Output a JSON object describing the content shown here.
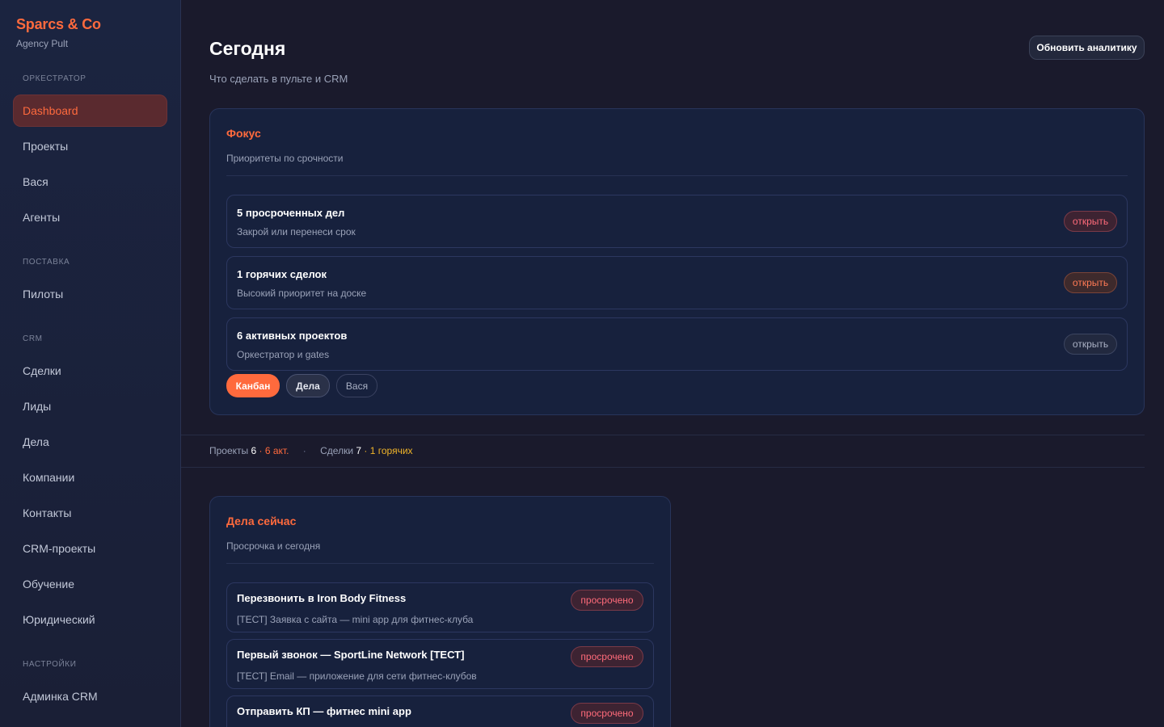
{
  "brand": {
    "title": "Sparcs & Co",
    "subtitle": "Agency Pult"
  },
  "sidebar": {
    "sections": [
      {
        "label": "ОРКЕСТРАТОР"
      },
      {
        "label": "ПОСТАВКА"
      },
      {
        "label": "CRM"
      },
      {
        "label": "НАСТРОЙКИ"
      }
    ],
    "items": [
      {
        "label": "Dashboard"
      },
      {
        "label": "Проекты"
      },
      {
        "label": "Вася"
      },
      {
        "label": "Агенты"
      },
      {
        "label": "Пилоты"
      },
      {
        "label": "Сделки"
      },
      {
        "label": "Лиды"
      },
      {
        "label": "Дела"
      },
      {
        "label": "Компании"
      },
      {
        "label": "Контакты"
      },
      {
        "label": "CRM-проекты"
      },
      {
        "label": "Обучение"
      },
      {
        "label": "Юридический"
      },
      {
        "label": "Админка CRM"
      }
    ]
  },
  "header": {
    "title": "Сегодня",
    "subtitle": "Что сделать в пульте и CRM",
    "refresh_label": "Обновить аналитику"
  },
  "focus": {
    "title": "Фокус",
    "subtitle": "Приоритеты по срочности",
    "rows": [
      {
        "title": "5 просроченных дел",
        "subtitle": "Закрой или перенеси срок",
        "action": "открыть"
      },
      {
        "title": "1 горячих сделок",
        "subtitle": "Высокий приоритет на доске",
        "action": "открыть"
      },
      {
        "title": "6 активных проектов",
        "subtitle": "Оркестратор и gates",
        "action": "открыть"
      }
    ],
    "chips": [
      {
        "label": "Канбан"
      },
      {
        "label": "Дела"
      },
      {
        "label": "Вася"
      }
    ]
  },
  "stats": {
    "projects_label": "Проекты",
    "projects_count": "6",
    "projects_active": "· 6 акт.",
    "separator": "·",
    "deals_label": "Сделки",
    "deals_count": "7",
    "deals_hot": "· 1 горячих"
  },
  "tasks": {
    "title": "Дела сейчас",
    "subtitle": "Просрочка и сегодня",
    "rows": [
      {
        "title": "Перезвонить в Iron Body Fitness",
        "subtitle": "[ТЕСТ] Заявка с сайта — mini app для фитнес-клуба",
        "status": "просрочено"
      },
      {
        "title": "Первый звонок — SportLine Network [ТЕСТ]",
        "subtitle": "[ТЕСТ] Email — приложение для сети фитнес-клубов",
        "status": "просрочено"
      },
      {
        "title": "Отправить КП — фитнес mini app",
        "subtitle": "",
        "status": "просрочено"
      }
    ]
  },
  "colors": {
    "accent": "#ff6a3d",
    "background": "#1a1a2c",
    "card": "#17213d",
    "overdue": "#ff6b7a",
    "hot": "#f0b429"
  }
}
